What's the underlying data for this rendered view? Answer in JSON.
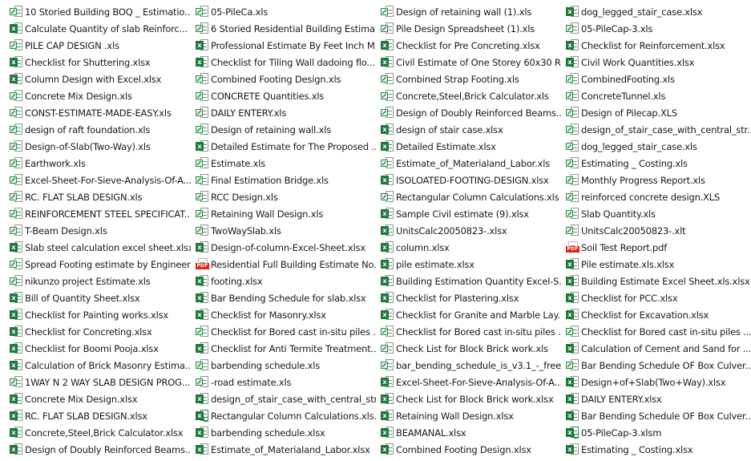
{
  "file_list": {
    "columns": [
      [
        {
          "name": "10 Storied Building BOQ _ Estimatio...",
          "type": "xls"
        },
        {
          "name": "Calculate Quantity of slab Reinforc...",
          "type": "xlsx"
        },
        {
          "name": "PILE CAP DESIGN .xls",
          "type": "xls"
        },
        {
          "name": "Checklist for Shuttering.xlsx",
          "type": "xlsx"
        },
        {
          "name": "Column Design with Excel.xlsx",
          "type": "xlsx"
        },
        {
          "name": "Concrete Mix Design.xls",
          "type": "xls"
        },
        {
          "name": "CONST-ESTIMATE-MADE-EASY.xls",
          "type": "xls"
        },
        {
          "name": "design of raft foundation.xls",
          "type": "xls"
        },
        {
          "name": "Design-of-Slab(Two-Way).xls",
          "type": "xls"
        },
        {
          "name": "Earthwork.xls",
          "type": "xls"
        },
        {
          "name": "Excel-Sheet-For-Sieve-Analysis-Of-A...",
          "type": "xls"
        },
        {
          "name": "RC. FLAT SLAB DESIGN.xls",
          "type": "xls"
        },
        {
          "name": "REINFORCEMENT STEEL SPECIFICAT...",
          "type": "xls"
        },
        {
          "name": "T-Beam Design.xls",
          "type": "xls"
        },
        {
          "name": "Slab steel calculation excel sheet.xlsx",
          "type": "xlsx"
        },
        {
          "name": "Spread Footing estimate by Engineer...",
          "type": "xls"
        },
        {
          "name": "nikunzo project  Estimate.xls",
          "type": "xls"
        },
        {
          "name": "Bill of Quantity Sheet.xlsx",
          "type": "xlsx"
        },
        {
          "name": "Checklist for Painting works.xlsx",
          "type": "xlsx"
        },
        {
          "name": "Checklist for Concreting.xlsx",
          "type": "xlsx"
        },
        {
          "name": "Checklist for Boomi Pooja.xlsx",
          "type": "xlsx"
        },
        {
          "name": "Calculation of Brick Masonry Estima...",
          "type": "xlsx"
        },
        {
          "name": "1WAY N 2 WAY SLAB DESIGN PROG...",
          "type": "xls"
        },
        {
          "name": "Concrete Mix Design.xlsx",
          "type": "xlsx"
        },
        {
          "name": "RC. FLAT SLAB DESIGN.xlsx",
          "type": "xlsx"
        },
        {
          "name": "Concrete,Steel,Brick Calculator.xlsx",
          "type": "xlsx"
        },
        {
          "name": "Design of Doubly Reinforced Beams....",
          "type": "xlsx"
        }
      ],
      [
        {
          "name": "05-PileCa.xls",
          "type": "xls"
        },
        {
          "name": "6 Storied Residential Building Estima...",
          "type": "xls"
        },
        {
          "name": "Professional Estimate By Feet Inch M...",
          "type": "xlsx"
        },
        {
          "name": "Checklist for Tiling Wall dadoing flo...",
          "type": "xlsx"
        },
        {
          "name": "Combined Footing Design.xls",
          "type": "xls"
        },
        {
          "name": "CONCRETE Quantities.xls",
          "type": "xls"
        },
        {
          "name": "DAILY ENTERY.xls",
          "type": "xls"
        },
        {
          "name": "Design of retaining wall.xls",
          "type": "xls"
        },
        {
          "name": "Detailed Estimate for The Proposed ...",
          "type": "xlsx"
        },
        {
          "name": "Estimate.xls",
          "type": "xls"
        },
        {
          "name": "Final Estimation Bridge.xls",
          "type": "xls"
        },
        {
          "name": "RCC Design.xls",
          "type": "xls"
        },
        {
          "name": "Retaining Wall Design.xls",
          "type": "xls"
        },
        {
          "name": "TwoWaySlab.xls",
          "type": "xls"
        },
        {
          "name": "Design-of-column-Excel-Sheet.xlsx",
          "type": "xlsx"
        },
        {
          "name": "Residential Full Building Estimate No...",
          "type": "pdf"
        },
        {
          "name": "footing.xlsx",
          "type": "xlsx"
        },
        {
          "name": "Bar Bending Schedule for slab.xlsx",
          "type": "xlsx"
        },
        {
          "name": "Checklist for Masonry.xlsx",
          "type": "xlsx"
        },
        {
          "name": "Checklist for Bored cast in-situ piles ...",
          "type": "xls"
        },
        {
          "name": "Checklist for Anti Termite Treatment...",
          "type": "xlsx"
        },
        {
          "name": "barbending schedule.xls",
          "type": "xls"
        },
        {
          "name": "-road estimate.xls",
          "type": "xls"
        },
        {
          "name": "design_of_stair_case_with_central_str...",
          "type": "xlsx"
        },
        {
          "name": "Rectangular Column Calculations.xls...",
          "type": "xlsm"
        },
        {
          "name": "barbending schedule.xlsx",
          "type": "xlsx"
        },
        {
          "name": "Estimate_of_Materialand_Labor.xlsx",
          "type": "xlsx"
        }
      ],
      [
        {
          "name": "Design of retaining wall (1).xls",
          "type": "xls"
        },
        {
          "name": "Pile Design Spreadsheet (1).xls",
          "type": "xls"
        },
        {
          "name": "Checklist for Pre Concreting.xlsx",
          "type": "xlsx"
        },
        {
          "name": "Civil Estimate of One Storey 60x30 R...",
          "type": "xlsx"
        },
        {
          "name": "Combined Strap Footing.xls",
          "type": "xls"
        },
        {
          "name": "Concrete,Steel,Brick Calculator.xls",
          "type": "xls"
        },
        {
          "name": "Design of Doubly Reinforced Beams....",
          "type": "xls"
        },
        {
          "name": "design of stair case.xlsx",
          "type": "xlsx"
        },
        {
          "name": "Detailed Estimate.xlsx",
          "type": "xlsx"
        },
        {
          "name": "Estimate_of_Materialand_Labor.xls",
          "type": "xls"
        },
        {
          "name": "ISOLOATED-FOOTING-DESIGN.xlsx",
          "type": "xlsx"
        },
        {
          "name": "Rectangular Column Calculations.xls",
          "type": "xls"
        },
        {
          "name": "Sample Civil estimate (9).xlsx",
          "type": "xlsx"
        },
        {
          "name": "UnitsCalc20050823-.xlsx",
          "type": "xlsx"
        },
        {
          "name": "column.xlsx",
          "type": "xlsx"
        },
        {
          "name": "pile estimate.xlsx",
          "type": "xlsx"
        },
        {
          "name": "Building Estimation Quantity Excel-S...",
          "type": "xlsx"
        },
        {
          "name": "Checklist for Plastering.xlsx",
          "type": "xlsx"
        },
        {
          "name": "Checklist for Granite and Marble Lay...",
          "type": "xlsx"
        },
        {
          "name": "Checklist for Bored cast in-situ piles ...",
          "type": "xls"
        },
        {
          "name": "Check List for Block Brick work.xls",
          "type": "xls"
        },
        {
          "name": "bar_bending_schedule_is_v3.1_-_free...",
          "type": "xls"
        },
        {
          "name": "Excel-Sheet-For-Sieve-Analysis-Of-A...",
          "type": "xlsx"
        },
        {
          "name": "Check List for Block Brick work.xlsx",
          "type": "xlsx"
        },
        {
          "name": "Retaining Wall Design.xlsx",
          "type": "xlsx"
        },
        {
          "name": "BEAMANAL.xlsx",
          "type": "xlsx"
        },
        {
          "name": "Combined Footing Design.xlsx",
          "type": "xlsx"
        }
      ],
      [
        {
          "name": "dog_legged_stair_case.xlsx",
          "type": "xlsx"
        },
        {
          "name": "05-PileCap-3.xls",
          "type": "xls"
        },
        {
          "name": "Checklist for Reinforcement.xlsx",
          "type": "xlsx"
        },
        {
          "name": "Civil Work Quantities.xlsx",
          "type": "xlsx"
        },
        {
          "name": "CombinedFooting.xls",
          "type": "xls"
        },
        {
          "name": "ConcreteTunnel.xls",
          "type": "xls"
        },
        {
          "name": "Design of Pilecap.XLS",
          "type": "xls"
        },
        {
          "name": "design_of_stair_case_with_central_str...",
          "type": "xls"
        },
        {
          "name": "dog_legged_stair_case.xls",
          "type": "xls"
        },
        {
          "name": "Estimating _ Costing.xls",
          "type": "xls"
        },
        {
          "name": "Monthly Progress Report.xls",
          "type": "xls"
        },
        {
          "name": "reinforced concrete design.XLS",
          "type": "xls"
        },
        {
          "name": "Slab Quantity.xls",
          "type": "xls"
        },
        {
          "name": "UnitsCalc20050823-.xlt",
          "type": "xls"
        },
        {
          "name": "Soil Test Report.pdf",
          "type": "pdf"
        },
        {
          "name": "Pile estimate.xls.xlsx",
          "type": "xlsx"
        },
        {
          "name": "Building Estimate Excel Sheet.xls.xlsx",
          "type": "xlsx"
        },
        {
          "name": "Checklist for PCC.xlsx",
          "type": "xlsx"
        },
        {
          "name": "Checklist for Excavation.xlsx",
          "type": "xlsx"
        },
        {
          "name": "Checklist for Bored cast in-situ piles ...",
          "type": "xls"
        },
        {
          "name": "Calculation of Cement and Sand for ...",
          "type": "xlsx"
        },
        {
          "name": "Bar Bending Schedule OF Box Culver...",
          "type": "xls"
        },
        {
          "name": "Design+of+Slab(Two+Way).xlsx",
          "type": "xlsx"
        },
        {
          "name": "DAILY ENTERY.xlsx",
          "type": "xlsx"
        },
        {
          "name": "Bar Bending Schedule OF Box Culver...",
          "type": "xlsx"
        },
        {
          "name": "05-PileCap-3.xlsm",
          "type": "xlsm"
        },
        {
          "name": "Estimating _ Costing.xlsx",
          "type": "xlsx"
        }
      ]
    ],
    "icon_names": {
      "xls": "excel-legacy-file-icon",
      "xlsx": "excel-file-icon",
      "xlsm": "excel-macro-file-icon",
      "pdf": "pdf-file-icon"
    },
    "badge_text": {
      "xlsx": "x",
      "xlsm": "x",
      "pdf": "PDF"
    }
  }
}
